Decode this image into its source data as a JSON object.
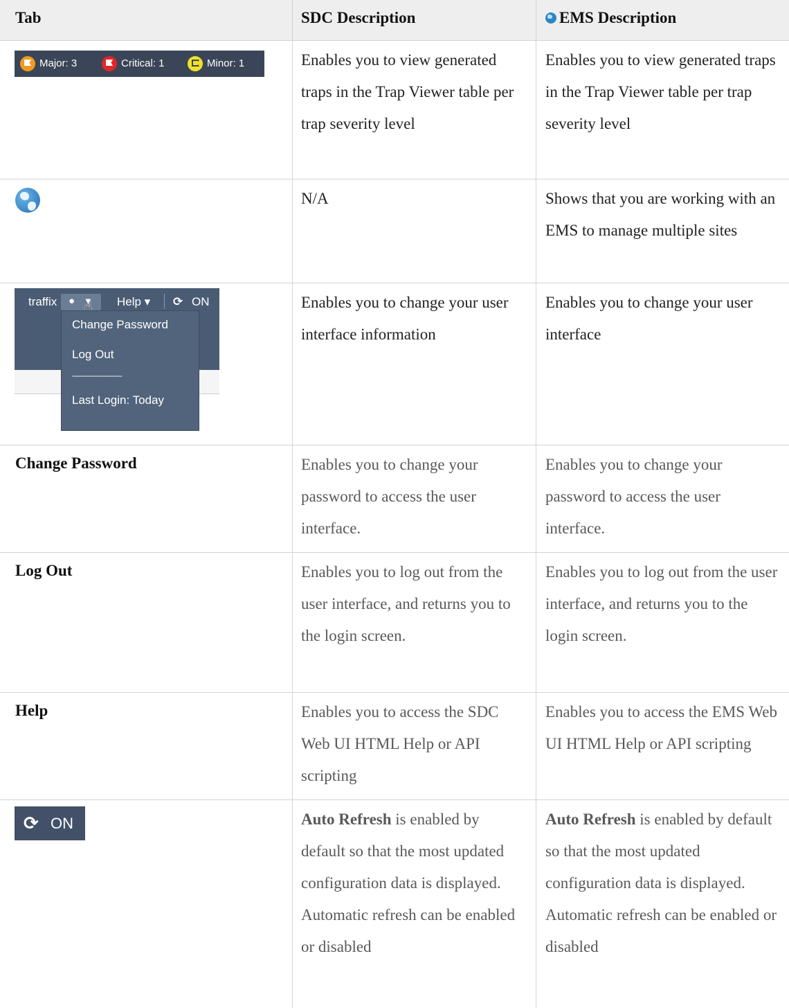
{
  "header": {
    "col1": "Tab",
    "col2": "SDC Description",
    "col3": "EMS Description"
  },
  "rows": [
    {
      "severity": {
        "major": "Major: 3",
        "critical": "Critical: 1",
        "minor": "Minor: 1",
        "colors": {
          "major": "#f39a1e",
          "critical": "#e0262b",
          "minor": "#f1e128"
        }
      },
      "sdc": "Enables you to view generated traps in the Trap Viewer table per trap severity level",
      "ems": "Enables you to view generated traps in the Trap Viewer table per trap severity level"
    },
    {
      "icon": "globe-icon",
      "sdc": "N/A",
      "ems": "Shows that you are working with an EMS to manage multiple sites"
    },
    {
      "menu": {
        "user": "traffix",
        "help": "Help ▾",
        "on": "ON",
        "items": [
          "Change Password",
          "Log Out",
          "---------------------------",
          "Last Login: Today"
        ]
      },
      "sdc": "Enables you to change your user interface information",
      "ems": "Enables you to change your user interface"
    },
    {
      "label": "Change Password",
      "sdc": "Enables you to change your password to access the user interface.",
      "ems": "Enables you to change your password to access the user interface."
    },
    {
      "label": "Log Out",
      "sdc": "Enables you to log out from the user interface, and returns you to the login screen.",
      "ems": "Enables you to log out from the user interface, and returns you to the login screen."
    },
    {
      "label": "Help",
      "sdc": "Enables you to access the SDC Web UI HTML Help or API scripting",
      "ems": "Enables you to access the EMS Web UI HTML Help or API scripting"
    },
    {
      "button": "ON",
      "button_icon": "refresh-icon",
      "sdc_strong": "Auto Refresh",
      "sdc": " is enabled by default so that the most updated configuration data is displayed. Automatic refresh can be enabled or disabled",
      "ems_strong": "Auto Refresh",
      "ems": " is enabled by default so that the most updated configuration data is displayed. Automatic refresh can be enabled or disabled"
    }
  ]
}
